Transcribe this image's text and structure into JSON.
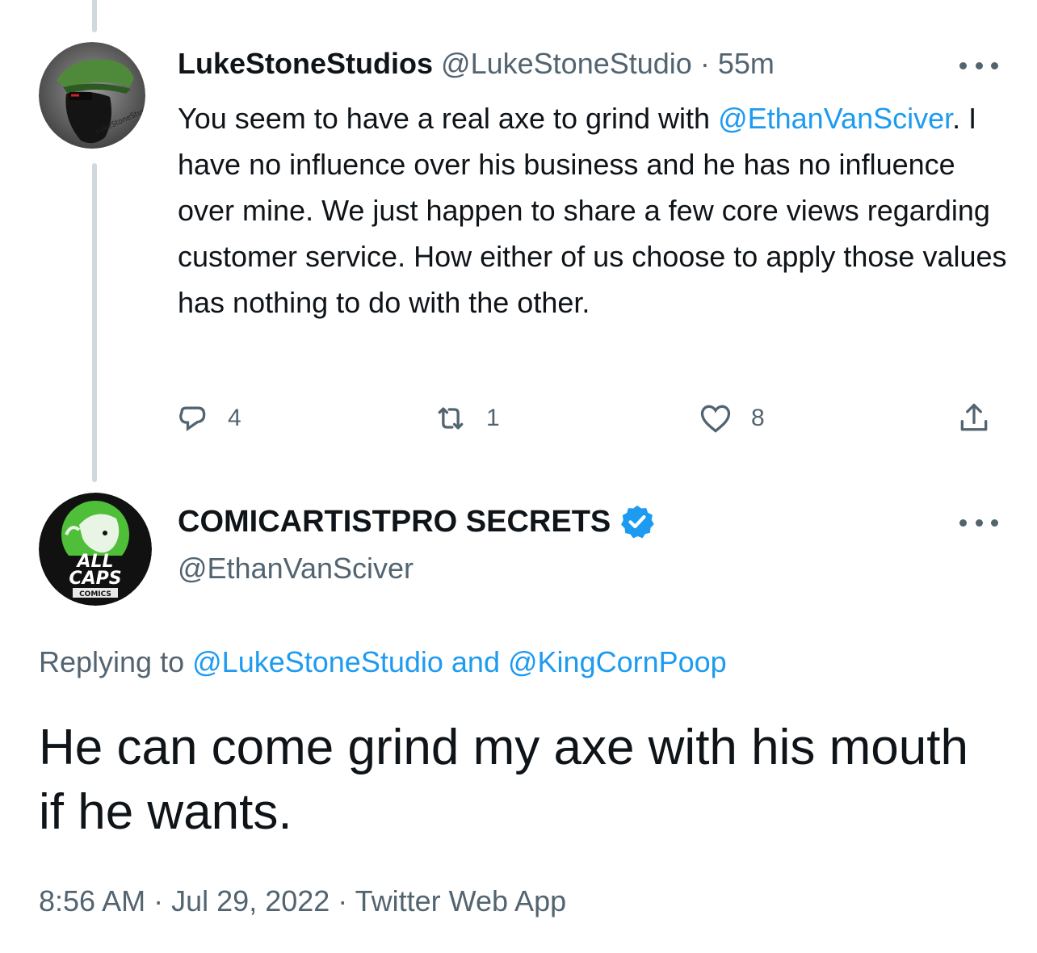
{
  "tweet1": {
    "display_name": "LukeStoneStudios",
    "handle": "@LukeStoneStudio",
    "separator": "·",
    "time": "55m",
    "avatar_text": "LukeStoneStudio",
    "text_mention": "@EthanVanSciver",
    "text_before": "You seem to have a real axe to grind with ",
    "text_after": ". I have no influence over his business and he has no influence over mine. We just happen to share a few core views regarding customer service. How either of us choose to apply those values has nothing to do with the other.",
    "reply_count": "4",
    "retweet_count": "1",
    "like_count": "8"
  },
  "tweet2": {
    "display_name": "COMICARTISTPRO SECRETS",
    "handle": "@EthanVanSciver",
    "avatar_text": {
      "line1": "ALL",
      "line2": "CAPS",
      "line3": "COMICS"
    },
    "replying_prefix": "Replying to",
    "replying_to_1": "@LukeStoneStudio",
    "replying_and": "and",
    "replying_to_2": "@KingCornPoop",
    "text": "He can come grind my axe with his mouth if he wants.",
    "time": "8:56 AM",
    "date": "Jul 29, 2022",
    "source": "Twitter Web App",
    "separator": "·"
  },
  "colors": {
    "accent": "#1d9bf0",
    "secondary_text": "#536471",
    "primary_text": "#0f1419",
    "thread_line": "#cfd9de"
  },
  "icons": [
    "more-icon",
    "reply-icon",
    "retweet-icon",
    "like-icon",
    "share-icon",
    "verified-badge-icon"
  ]
}
